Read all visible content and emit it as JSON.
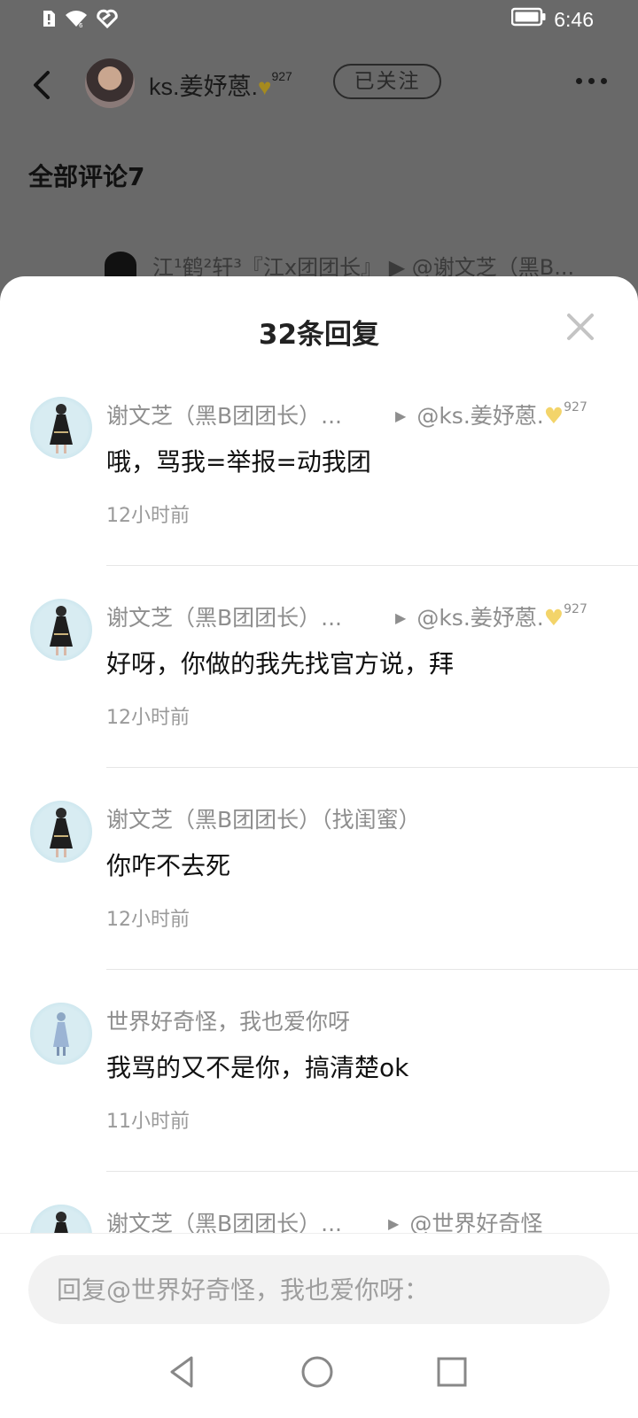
{
  "status_bar": {
    "time": "6:46",
    "icons": [
      "alert-sim-icon",
      "wifi-icon",
      "hotspot-icon",
      "battery-icon"
    ]
  },
  "header": {
    "author_name": "ks.姜妤蒽.",
    "author_badge_num": "927",
    "follow_label": "已关注",
    "section_title": "全部评论7",
    "peek_text": "江¹鹤²轩³『江x团团长』 ▶ @谢文芝（黑B..."
  },
  "sheet": {
    "title": "32条回复",
    "comments": [
      {
        "name": "谢文芝（黑B团团长）...",
        "reply_to": "@ks.姜妤蒽.",
        "reply_badge": "927",
        "text": "哦，骂我=举报=动我团",
        "time": "12小时前"
      },
      {
        "name": "谢文芝（黑B团团长）...",
        "reply_to": "@ks.姜妤蒽.",
        "reply_badge": "927",
        "text": "好呀，你做的我先找官方说，拜",
        "time": "12小时前"
      },
      {
        "name": "谢文芝（黑B团团长）（找闺蜜）",
        "text": "你咋不去死",
        "time": "12小时前"
      },
      {
        "name": "世界好奇怪，我也爱你呀",
        "text": "我骂的又不是你，搞清楚ok",
        "time": "11小时前"
      },
      {
        "name": "谢文芝（黑B团团长）...",
        "reply_to": "@世界好奇怪",
        "text": "",
        "time": ""
      }
    ]
  },
  "input": {
    "placeholder": "回复@世界好奇怪，我也爱你呀："
  },
  "nav": {
    "buttons": [
      "back-triangle-icon",
      "home-circle-icon",
      "recents-square-icon"
    ]
  }
}
